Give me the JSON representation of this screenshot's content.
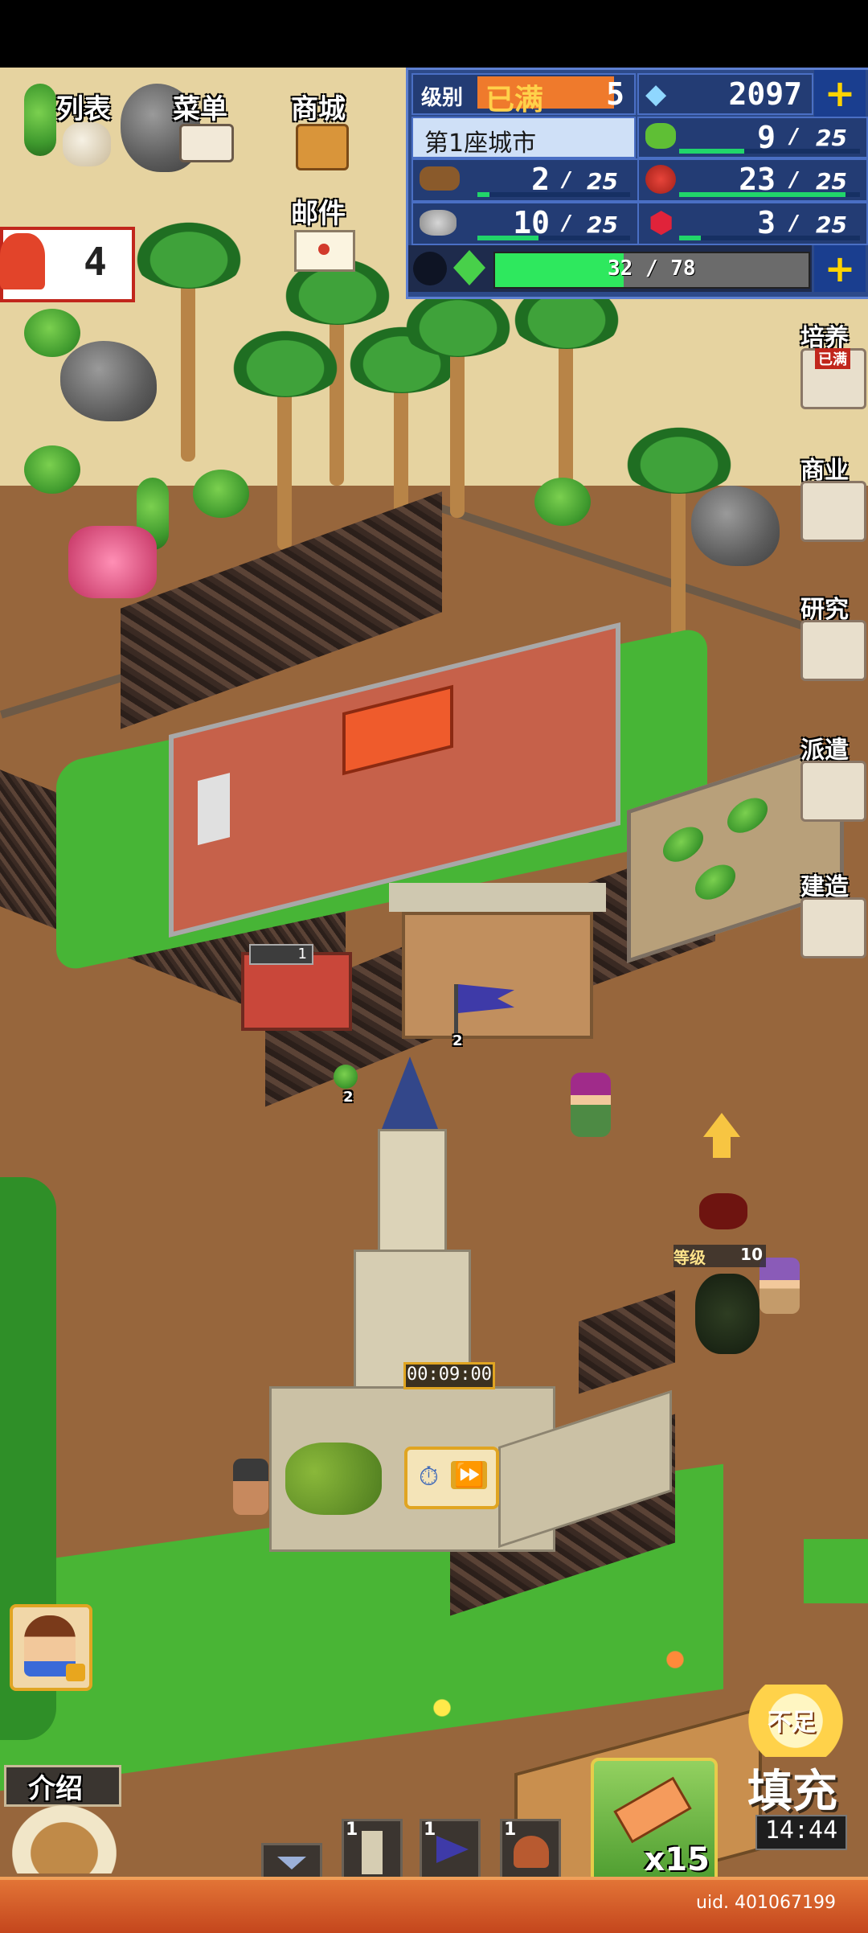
{
  "menu": {
    "list_label": "列表",
    "menu_label": "菜单",
    "shop_label": "商城",
    "mail_label": "邮件",
    "notification_count": "4"
  },
  "stats": {
    "level_label": "级别",
    "level_status": "已满",
    "level_value": "5",
    "gems": "2097",
    "city_name": "第1座城市",
    "grass": {
      "current": "9",
      "max": "25",
      "fraction": 0.36
    },
    "wood": {
      "current": "2",
      "max": "25",
      "fraction": 0.08
    },
    "food": {
      "current": "23",
      "max": "25",
      "fraction": 0.92
    },
    "stone": {
      "current": "10",
      "max": "25",
      "fraction": 0.4
    },
    "ruby": {
      "current": "3",
      "max": "25",
      "fraction": 0.12
    },
    "energy": {
      "current": "32",
      "max": "78",
      "separator": "/",
      "fraction": 0.41
    }
  },
  "side_menu": {
    "train_label": "培养",
    "train_badge": "已满",
    "business_label": "商业",
    "research_label": "研究",
    "dispatch_label": "派遣",
    "build_label": "建造"
  },
  "map": {
    "shop_count": "1",
    "flag_count": "2",
    "grass_count": "2",
    "enemy_level_label": "等级",
    "enemy_level_value": "10",
    "build_timer": "00:09:00"
  },
  "bottom": {
    "intro_label": "介绍",
    "slot1_count": "1",
    "slot2_count": "1",
    "slot3_count": "1",
    "hammer_count": "x15",
    "fill_badge": "不足",
    "fill_label": "填充",
    "fill_timer": "14:44",
    "uid": "uid. 401067199"
  },
  "colors": {
    "panel_blue": "#2d4a8a",
    "bar_green": "#21d56a",
    "plus_yellow": "#ffd300",
    "accent_orange": "#e27436"
  }
}
